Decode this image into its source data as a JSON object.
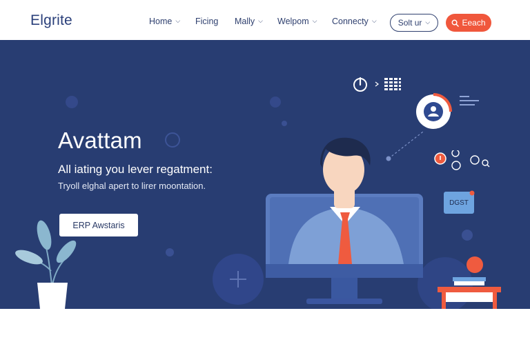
{
  "brand": {
    "logo": "Elgrite"
  },
  "nav": {
    "items": [
      {
        "label": "Home",
        "has_dropdown": true
      },
      {
        "label": "Ficing",
        "has_dropdown": false
      },
      {
        "label": "Mally",
        "has_dropdown": true
      },
      {
        "label": "Welpom",
        "has_dropdown": true
      },
      {
        "label": "Connecty",
        "has_dropdown": true
      }
    ],
    "signup_label": "Solt ur",
    "search_label": "Eeach"
  },
  "hero": {
    "title": "Avattam",
    "subtitle": "All iating you lever regatment:",
    "description": "Tryoll elghal apert to lirer moontation.",
    "cta_label": "ERP Awstaris"
  },
  "illustration": {
    "badge_label": "DGST"
  },
  "colors": {
    "hero_bg": "#283d72",
    "accent": "#f0573c",
    "brand_text": "#2a3f7a",
    "header_bg": "#ffffff"
  },
  "icons": [
    "chevron-down-icon",
    "search-icon",
    "power-icon",
    "grid-icon",
    "user-icon",
    "search-icon",
    "plus-icon",
    "plant-icon"
  ]
}
